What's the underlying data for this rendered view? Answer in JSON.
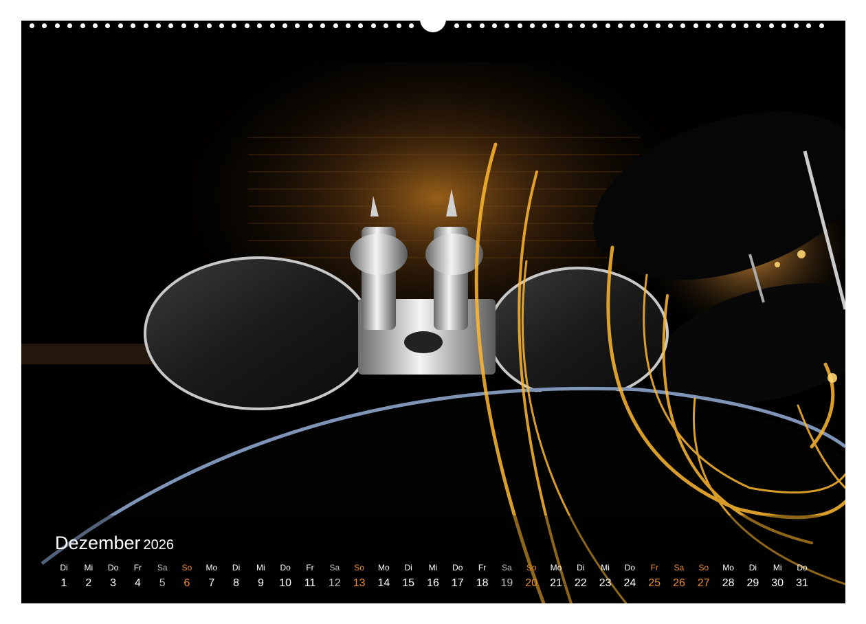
{
  "calendar": {
    "month": "Dezember",
    "year": "2026",
    "days": [
      {
        "wd": "Di",
        "d": "1",
        "t": "n"
      },
      {
        "wd": "Mi",
        "d": "2",
        "t": "n"
      },
      {
        "wd": "Do",
        "d": "3",
        "t": "n"
      },
      {
        "wd": "Fr",
        "d": "4",
        "t": "n"
      },
      {
        "wd": "Sa",
        "d": "5",
        "t": "s"
      },
      {
        "wd": "So",
        "d": "6",
        "t": "h"
      },
      {
        "wd": "Mo",
        "d": "7",
        "t": "n"
      },
      {
        "wd": "Di",
        "d": "8",
        "t": "n"
      },
      {
        "wd": "Mi",
        "d": "9",
        "t": "n"
      },
      {
        "wd": "Do",
        "d": "10",
        "t": "n"
      },
      {
        "wd": "Fr",
        "d": "11",
        "t": "n"
      },
      {
        "wd": "Sa",
        "d": "12",
        "t": "s"
      },
      {
        "wd": "So",
        "d": "13",
        "t": "h"
      },
      {
        "wd": "Mo",
        "d": "14",
        "t": "n"
      },
      {
        "wd": "Di",
        "d": "15",
        "t": "n"
      },
      {
        "wd": "Mi",
        "d": "16",
        "t": "n"
      },
      {
        "wd": "Do",
        "d": "17",
        "t": "n"
      },
      {
        "wd": "Fr",
        "d": "18",
        "t": "n"
      },
      {
        "wd": "Sa",
        "d": "19",
        "t": "s"
      },
      {
        "wd": "So",
        "d": "20",
        "t": "h"
      },
      {
        "wd": "Mo",
        "d": "21",
        "t": "n"
      },
      {
        "wd": "Di",
        "d": "22",
        "t": "n"
      },
      {
        "wd": "Mi",
        "d": "23",
        "t": "n"
      },
      {
        "wd": "Do",
        "d": "24",
        "t": "n"
      },
      {
        "wd": "Fr",
        "d": "25",
        "t": "h"
      },
      {
        "wd": "Sa",
        "d": "26",
        "t": "h"
      },
      {
        "wd": "So",
        "d": "27",
        "t": "h"
      },
      {
        "wd": "Mo",
        "d": "28",
        "t": "n"
      },
      {
        "wd": "Di",
        "d": "29",
        "t": "n"
      },
      {
        "wd": "Mi",
        "d": "30",
        "t": "n"
      },
      {
        "wd": "Do",
        "d": "31",
        "t": "n"
      }
    ]
  },
  "colors": {
    "background": "#000000",
    "text": "#ffffff",
    "holiday_weekend": "#e58a2e",
    "saturday": "#bdbdbd",
    "light_trail": "#ffb830"
  }
}
